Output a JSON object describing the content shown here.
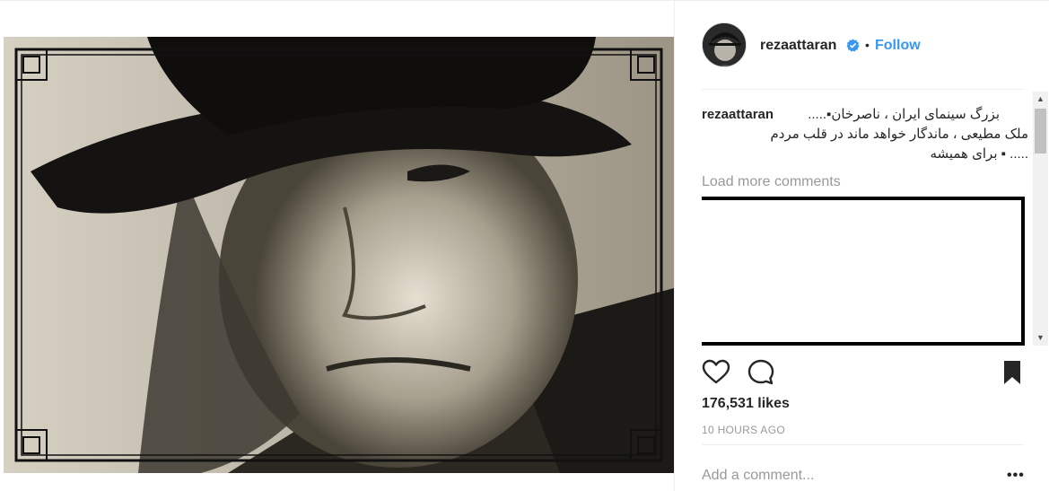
{
  "post": {
    "username": "rezaattaran",
    "follow_label": "Follow",
    "separator": "•",
    "caption_user": "rezaattaran",
    "caption_text": "بزرگ سینمای ایران ، ناصرخان▪.....\nملک مطیعی ، ماندگار خواهد ماند در قلب مردم\n..... ▪ برای همیشه",
    "load_more": "Load more comments",
    "likes": "176,531 likes",
    "time": "10 HOURS AGO",
    "comment_placeholder": "Add a comment...",
    "more_label": "•••"
  },
  "icons": {
    "verified": "verified-badge-icon",
    "like": "heart-icon",
    "comment": "comment-icon",
    "save": "bookmark-icon"
  },
  "colors": {
    "accent": "#3897f0",
    "text": "#262626",
    "muted": "#999999",
    "border": "#efefef"
  }
}
